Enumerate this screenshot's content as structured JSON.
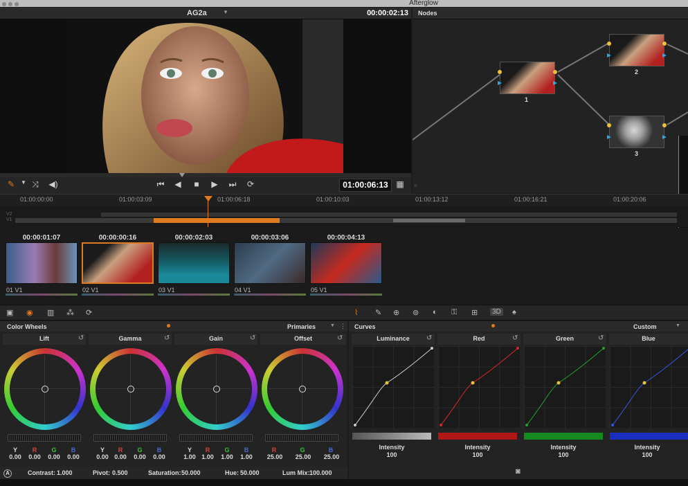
{
  "window": {
    "title": "Afterglow"
  },
  "viewer": {
    "clip_name": "AG2a",
    "timecode": "00:00:02:13",
    "transport_timecode": "01:00:06:13"
  },
  "nodes": {
    "title": "Nodes",
    "items": [
      {
        "label": "1"
      },
      {
        "label": "2"
      },
      {
        "label": "3"
      }
    ]
  },
  "timeline": {
    "ticks": [
      "01:00:00:00",
      "01:00:03:09",
      "01:00:06:18",
      "01:00:10:03",
      "01:00:13:12",
      "01:00:16:21",
      "01:00:20:06"
    ],
    "tracks": [
      "V2",
      "V1"
    ]
  },
  "clips": [
    {
      "tc": "00:00:01:07",
      "num": "01",
      "track": "V1"
    },
    {
      "tc": "00:00:00:16",
      "num": "02",
      "track": "V1",
      "selected": true
    },
    {
      "tc": "00:00:02:03",
      "num": "03",
      "track": "V1"
    },
    {
      "tc": "00:00:03:06",
      "num": "04",
      "track": "V1"
    },
    {
      "tc": "00:00:04:13",
      "num": "05",
      "track": "V1"
    }
  ],
  "color_wheels": {
    "title": "Color Wheels",
    "mode": "Primaries",
    "wheels": [
      {
        "name": "Lift",
        "values": [
          "0.00",
          "0.00",
          "0.00",
          "0.00"
        ]
      },
      {
        "name": "Gamma",
        "values": [
          "0.00",
          "0.00",
          "0.00",
          "0.00"
        ]
      },
      {
        "name": "Gain",
        "values": [
          "1.00",
          "1.00",
          "1.00",
          "1.00"
        ]
      },
      {
        "name": "Offset",
        "values": [
          "25.00",
          "25.00",
          "25.00"
        ]
      }
    ],
    "channels": [
      "Y",
      "R",
      "G",
      "B"
    ],
    "bottom": {
      "contrast_label": "Contrast:",
      "contrast": "1.000",
      "pivot_label": "Pivot:",
      "pivot": "0.500",
      "saturation_label": "Saturation:",
      "saturation": "50.000",
      "hue_label": "Hue:",
      "hue": "50.000",
      "lummix_label": "Lum Mix:",
      "lummix": "100.000"
    }
  },
  "curves": {
    "title": "Curves",
    "mode": "Custom",
    "channels": [
      {
        "name": "Luminance",
        "intensity": "100",
        "color": "#bfbfbf"
      },
      {
        "name": "Red",
        "intensity": "100",
        "color": "#c42020"
      },
      {
        "name": "Green",
        "intensity": "100",
        "color": "#1f9a2a"
      },
      {
        "name": "Blue",
        "intensity": "100",
        "color": "#2a3fd0"
      }
    ],
    "intensity_label": "Intensity"
  },
  "toolbar": {
    "threed_label": "3D"
  },
  "colors": {
    "accent": "#e07a1e",
    "node_dot": "#e8c33a",
    "node_arrow": "#2fa7e0"
  }
}
